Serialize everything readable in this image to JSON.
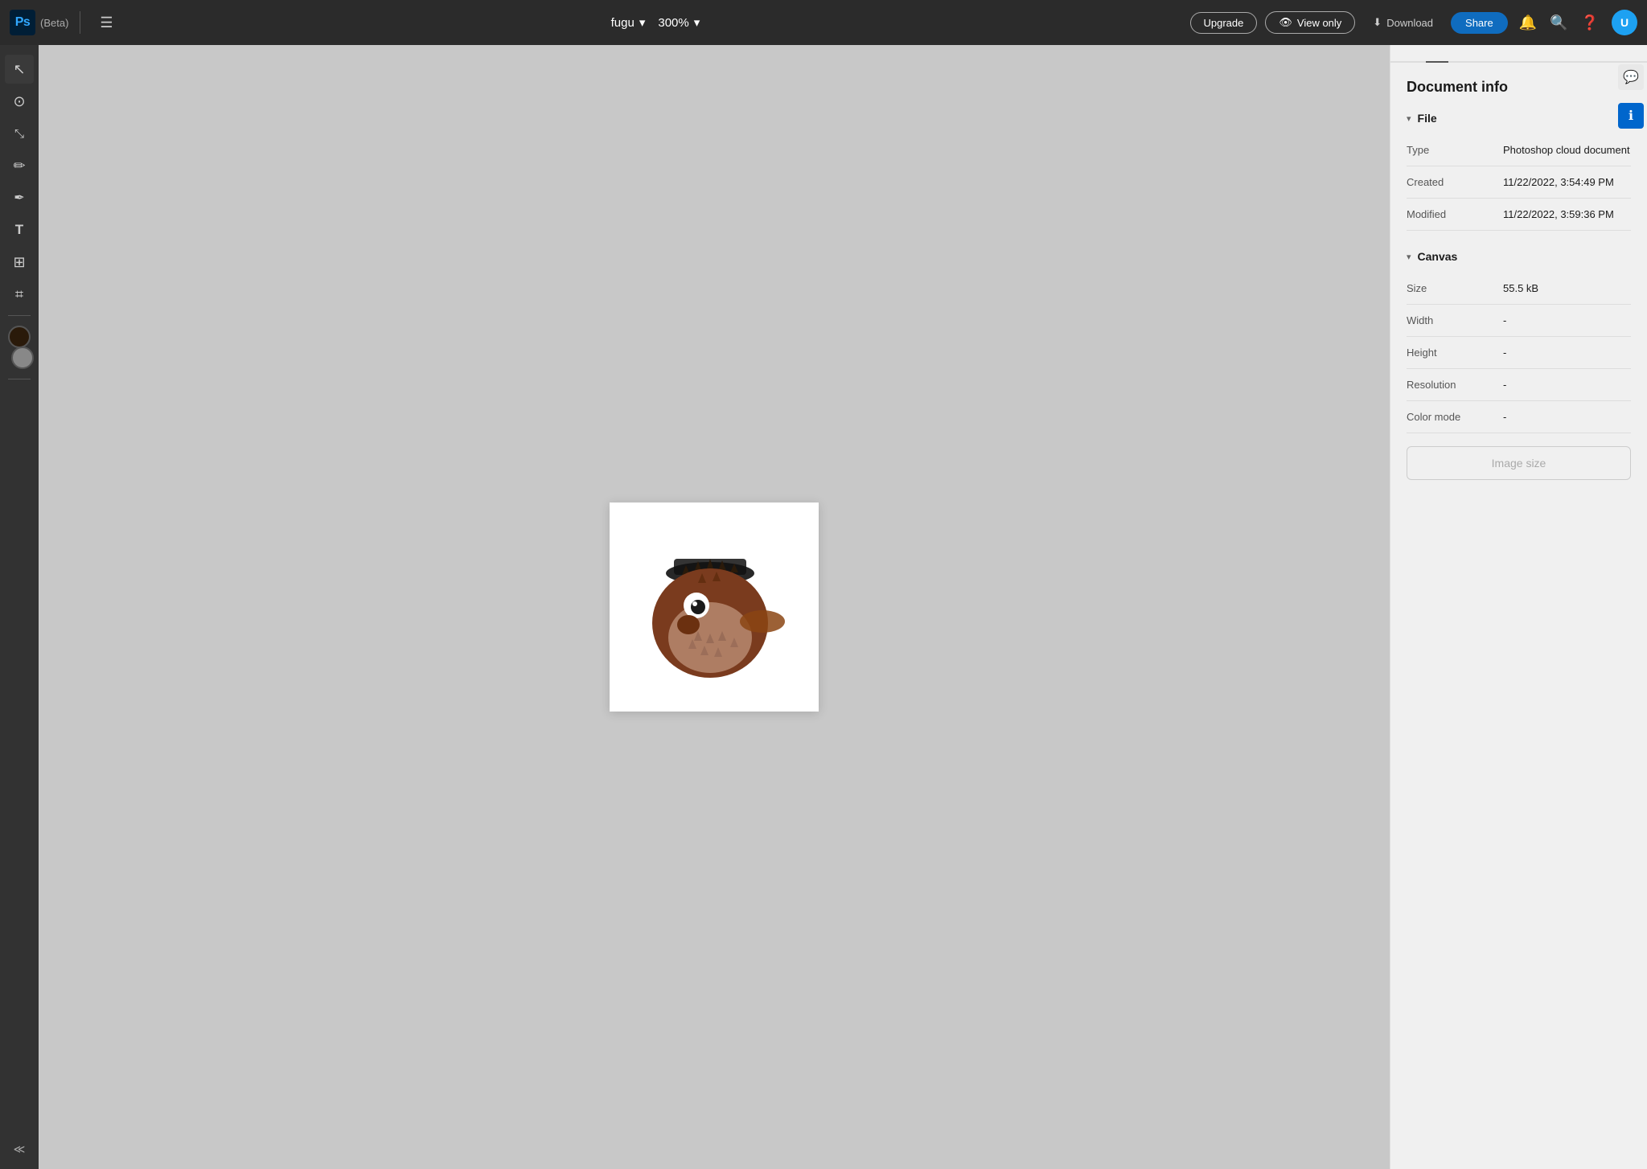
{
  "app": {
    "logo_text": "Ps",
    "beta_label": "(Beta)",
    "filename": "fugu",
    "zoom": "300%"
  },
  "topbar": {
    "upgrade_label": "Upgrade",
    "view_only_label": "View only",
    "download_label": "Download",
    "share_label": "Share"
  },
  "tools": [
    {
      "name": "select-tool",
      "icon": "↖",
      "label": "Select"
    },
    {
      "name": "lasso-tool",
      "icon": "⊙",
      "label": "Lasso"
    },
    {
      "name": "transform-tool",
      "icon": "⤢",
      "label": "Transform"
    },
    {
      "name": "brush-tool",
      "icon": "✏",
      "label": "Brush"
    },
    {
      "name": "pen-tool",
      "icon": "/",
      "label": "Pen"
    },
    {
      "name": "text-tool",
      "icon": "T",
      "label": "Text"
    },
    {
      "name": "shape-tool",
      "icon": "⊞",
      "label": "Shape"
    },
    {
      "name": "eyedropper-tool",
      "icon": "⌗",
      "label": "Eyedropper"
    }
  ],
  "color_fg": "#333333",
  "color_bg": "#888888",
  "panel": {
    "title": "Document info",
    "tabs": [
      {
        "id": "tab1",
        "label": ""
      },
      {
        "id": "tab2",
        "label": ""
      },
      {
        "id": "tab3",
        "label": ""
      }
    ],
    "sections": {
      "file": {
        "header": "File",
        "rows": [
          {
            "label": "Type",
            "value": "Photoshop cloud document"
          },
          {
            "label": "Created",
            "value": "11/22/2022, 3:54:49 PM"
          },
          {
            "label": "Modified",
            "value": "11/22/2022, 3:59:36 PM"
          }
        ]
      },
      "canvas": {
        "header": "Canvas",
        "rows": [
          {
            "label": "Size",
            "value": "55.5 kB"
          },
          {
            "label": "Width",
            "value": "-"
          },
          {
            "label": "Height",
            "value": "-"
          },
          {
            "label": "Resolution",
            "value": "-"
          },
          {
            "label": "Color mode",
            "value": "-"
          }
        ]
      }
    },
    "image_size_label": "Image size"
  }
}
